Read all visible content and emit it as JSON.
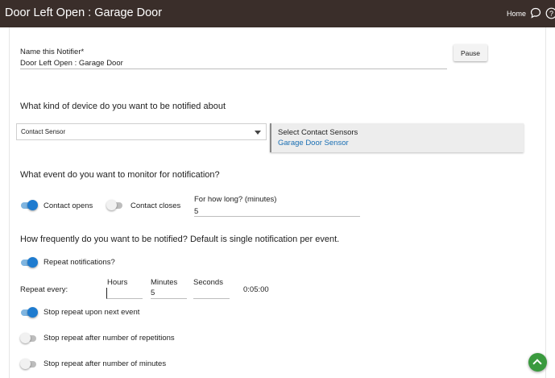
{
  "header": {
    "title": "Door Left Open : Garage Door",
    "home_label": "Home",
    "chat_icon": "chat-bubble-icon",
    "help_icon": "help-circle-icon",
    "bg_color": "#3a2e2a"
  },
  "name_field": {
    "label": "Name this Notifier*",
    "value": "Door Left Open : Garage Door"
  },
  "pause_button": {
    "label": "Pause"
  },
  "device_section": {
    "question": "What kind of device do you want to be notified about",
    "select_value": "Contact Sensor",
    "selector_heading": "Select Contact Sensors",
    "selected_device": "Garage Door Sensor"
  },
  "event_section": {
    "question": "What event do you want to monitor for notification?",
    "contact_opens": {
      "label": "Contact opens",
      "on": true
    },
    "contact_closes": {
      "label": "Contact closes",
      "on": false
    },
    "duration_label": "For how long? (minutes)",
    "duration_value": "5"
  },
  "frequency_section": {
    "question": "How frequently do you want to be notified?  Default is single notification per event.",
    "repeat_notifications": {
      "label": "Repeat notifications?",
      "on": true
    },
    "repeat_every_label": "Repeat every:",
    "hours_label": "Hours",
    "hours_value": "",
    "minutes_label": "Minutes",
    "minutes_value": "5",
    "seconds_label": "Seconds",
    "seconds_value": "",
    "computed_interval": "0:05:00",
    "stop_next_event": {
      "label": "Stop repeat upon next event",
      "on": true
    },
    "stop_after_repetitions": {
      "label": "Stop repeat after number of repetitions",
      "on": false
    },
    "stop_after_minutes": {
      "label": "Stop repeat after number of minutes",
      "on": false
    }
  },
  "colors": {
    "accent_blue": "#1e7bcf",
    "fab_green": "#3a9a3e",
    "link_blue": "#1a6fb3"
  },
  "fab_icon": "chevron-up-icon"
}
